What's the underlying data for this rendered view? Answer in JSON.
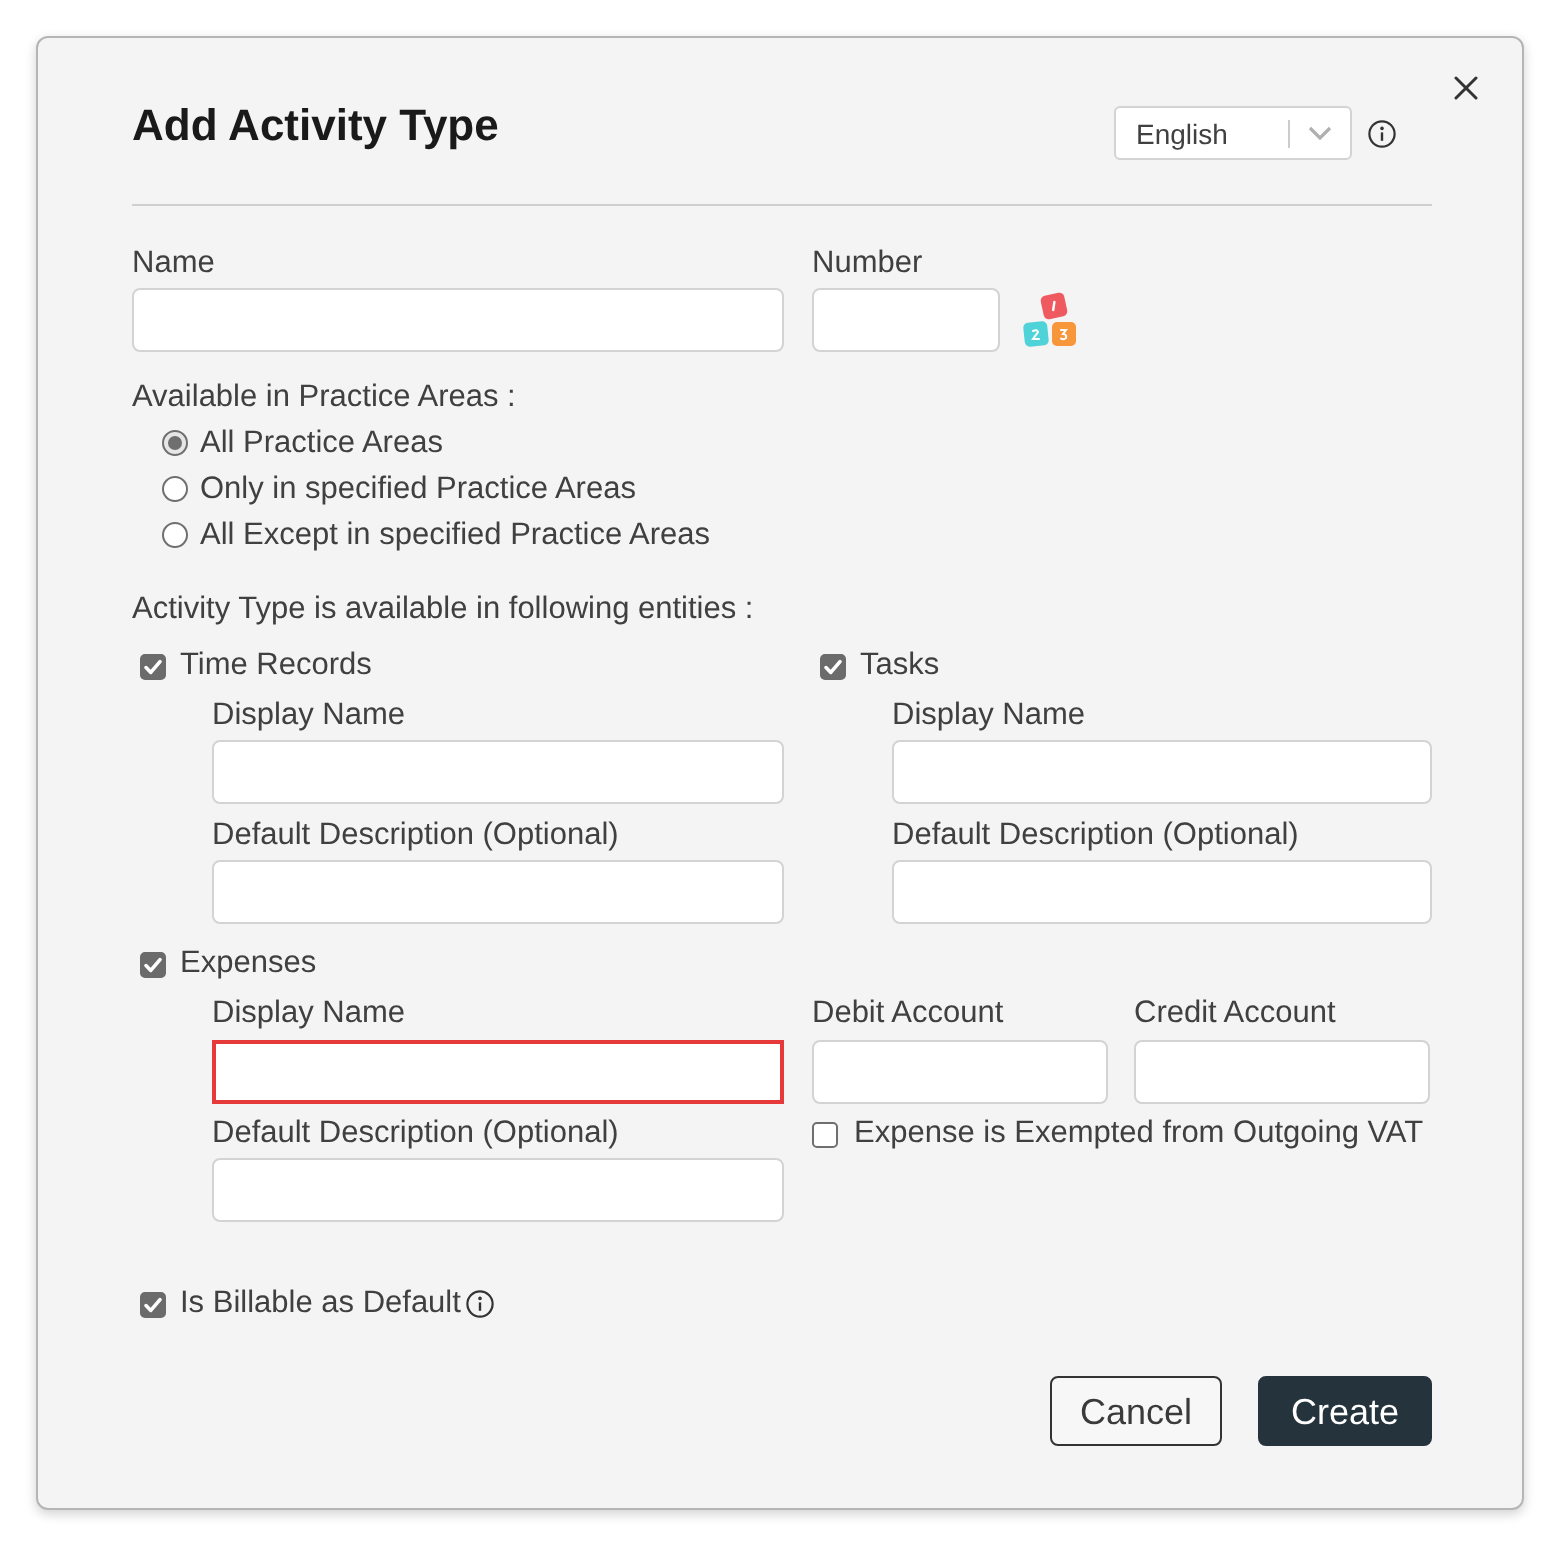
{
  "dialog": {
    "title": "Add Activity Type"
  },
  "language_select": {
    "value": "English"
  },
  "name_field": {
    "label": "Name"
  },
  "number_field": {
    "label": "Number"
  },
  "practice_areas": {
    "label": "Available in Practice Areas :",
    "options": [
      {
        "label": "All Practice Areas",
        "selected": true
      },
      {
        "label": "Only in specified Practice Areas",
        "selected": false
      },
      {
        "label": "All Except in specified Practice Areas",
        "selected": false
      }
    ]
  },
  "entities": {
    "label": "Activity Type is available in following entities :",
    "items": [
      {
        "kind": "basic",
        "label": "Time Records",
        "checked": true,
        "fields": [
          {
            "label": "Display Name",
            "invalid": false
          },
          {
            "label": "Default Description (Optional)",
            "invalid": false
          }
        ]
      },
      {
        "kind": "basic",
        "label": "Tasks",
        "checked": true,
        "fields": [
          {
            "label": "Display Name",
            "invalid": false
          },
          {
            "label": "Default Description (Optional)",
            "invalid": false
          }
        ]
      },
      {
        "kind": "expense",
        "label": "Expenses",
        "checked": true,
        "fields": [
          {
            "label": "Display Name",
            "invalid": true
          },
          {
            "label": "Default Description (Optional)",
            "invalid": false
          }
        ],
        "accounts": [
          {
            "label": "Debit Account"
          },
          {
            "label": "Credit Account"
          }
        ],
        "vat_exempt": {
          "label": "Expense is Exempted from Outgoing VAT",
          "checked": false
        }
      }
    ]
  },
  "billable": {
    "label": "Is Billable as Default",
    "checked": true
  },
  "buttons": [
    {
      "label": "Cancel",
      "kind": "secondary"
    },
    {
      "label": "Create",
      "kind": "primary"
    }
  ]
}
